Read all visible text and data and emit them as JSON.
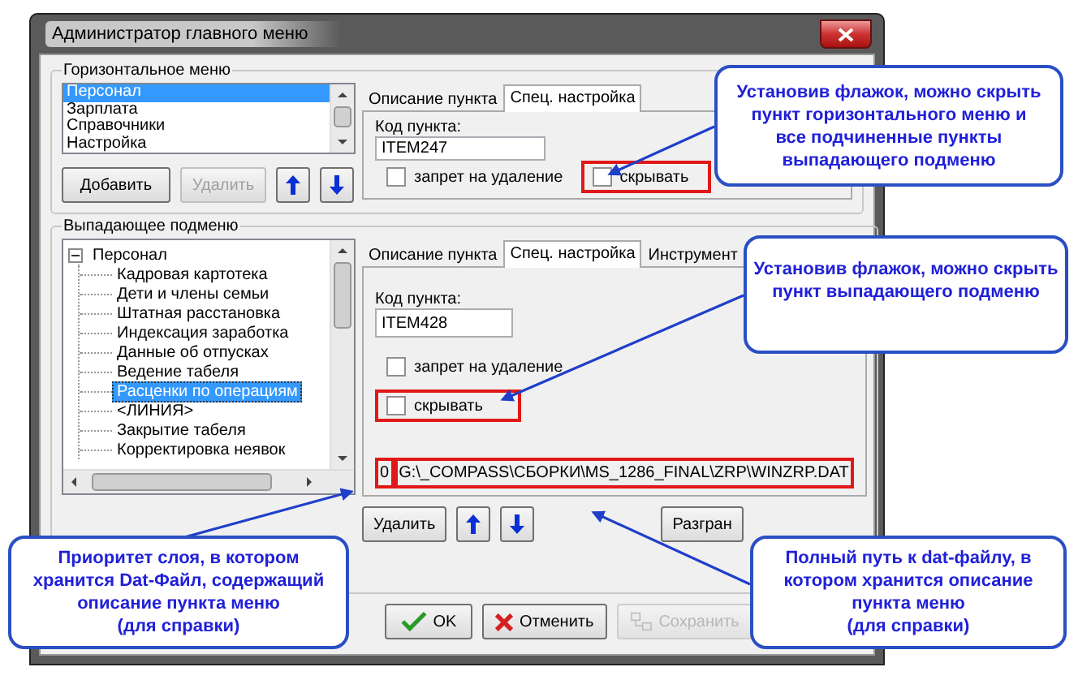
{
  "window": {
    "title": "Администратор главного меню"
  },
  "horizontal_menu": {
    "title": "Горизонтальное меню",
    "items": [
      {
        "label": "Персонал",
        "selected": true
      },
      {
        "label": "Зарплата",
        "selected": false
      },
      {
        "label": "Справочники",
        "selected": false
      },
      {
        "label": "Настройка",
        "selected": false
      }
    ],
    "buttons": [
      {
        "label": "Добавить",
        "disabled": false
      },
      {
        "label": "Удалить",
        "disabled": true
      }
    ],
    "tabs": [
      {
        "label": "Описание пункта",
        "selected": false
      },
      {
        "label": "Спец. настройка",
        "selected": true
      }
    ],
    "code_label": "Код пункта:",
    "code_value": "ITEM247",
    "checkboxes": [
      {
        "label": "запрет на удаление",
        "checked": false,
        "highlighted": false
      },
      {
        "label": "скрывать",
        "checked": false,
        "highlighted": true
      }
    ]
  },
  "dropdown_menu": {
    "title": "Выпадающее подменю",
    "tree": [
      {
        "label": "Персонал",
        "expanded": true,
        "selected": false,
        "children": [
          {
            "label": "Кадровая картотека",
            "selected": false
          },
          {
            "label": "Дети и члены семьи",
            "selected": false
          },
          {
            "label": "Штатная расстановка",
            "selected": false
          },
          {
            "label": "Индексация заработка",
            "selected": false
          },
          {
            "label": "Данные об отпусках",
            "selected": false
          },
          {
            "label": "Ведение табеля",
            "selected": false
          },
          {
            "label": "Расценки по операциям",
            "selected": true
          },
          {
            "label": "<ЛИНИЯ>",
            "selected": false
          },
          {
            "label": "Закрытие табеля",
            "selected": false
          },
          {
            "label": "Корректировка неявок",
            "selected": false
          }
        ]
      }
    ],
    "tabs": [
      {
        "label": "Описание пункта",
        "selected": false
      },
      {
        "label": "Спец. настройка",
        "selected": true
      },
      {
        "label": "Инструмент",
        "selected": false
      }
    ],
    "code_label": "Код пункта:",
    "code_value": "ITEM428",
    "checkboxes": [
      {
        "label": "запрет на удаление",
        "checked": false,
        "highlighted": false
      },
      {
        "label": "скрывать",
        "checked": false,
        "highlighted": true
      }
    ],
    "layer_priority": {
      "value": "0",
      "highlighted": true
    },
    "file_path": {
      "value": "G:\\_COMPASS\\СБОРКИ\\MS_1286_FINAL\\ZRP\\WINZRP.DAT",
      "highlighted": true
    },
    "buttons": [
      {
        "kind": "text",
        "label": "Удалить",
        "disabled": false
      },
      {
        "kind": "up",
        "disabled": false
      },
      {
        "kind": "down",
        "disabled": false
      },
      {
        "kind": "text",
        "label": "Разгран",
        "disabled": false
      }
    ]
  },
  "dialog_buttons": [
    {
      "kind": "ok",
      "label": "OK",
      "disabled": false
    },
    {
      "kind": "cancel",
      "label": "Отменить",
      "disabled": false
    },
    {
      "kind": "save",
      "label": "Сохранить",
      "disabled": true
    }
  ],
  "callouts": [
    {
      "text": "Установив флажок, можно скрыть\nпункт горизонтального меню и\nвсе подчиненные пункты\nвыпадающего подменю"
    },
    {
      "text": "Установив флажок, можно скрыть\nпункт выпадающего подменю"
    },
    {
      "text": "Приоритет слоя, в котором\nхранится Dat-Файл, содержащий\nописание пункта меню\n(для справки)"
    },
    {
      "text": "Полный путь к dat-файлу, в\nкотором хранится описание\nпункта меню\n(для справки)"
    }
  ]
}
